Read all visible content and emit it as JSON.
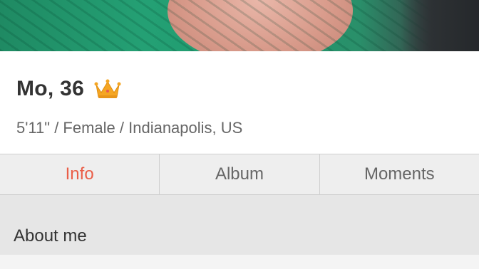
{
  "profile": {
    "photo_icon": "profile-photo",
    "name_age": "Mo, 36",
    "crown_icon": "crown-icon",
    "details": "5'11\" / Female / Indianapolis, US"
  },
  "tabs": [
    {
      "label": "Info",
      "active": true
    },
    {
      "label": "Album",
      "active": false
    },
    {
      "label": "Moments",
      "active": false
    }
  ],
  "sections": {
    "about_title": "About me"
  },
  "colors": {
    "accent": "#ea5e48",
    "crown": "#f5a623"
  }
}
